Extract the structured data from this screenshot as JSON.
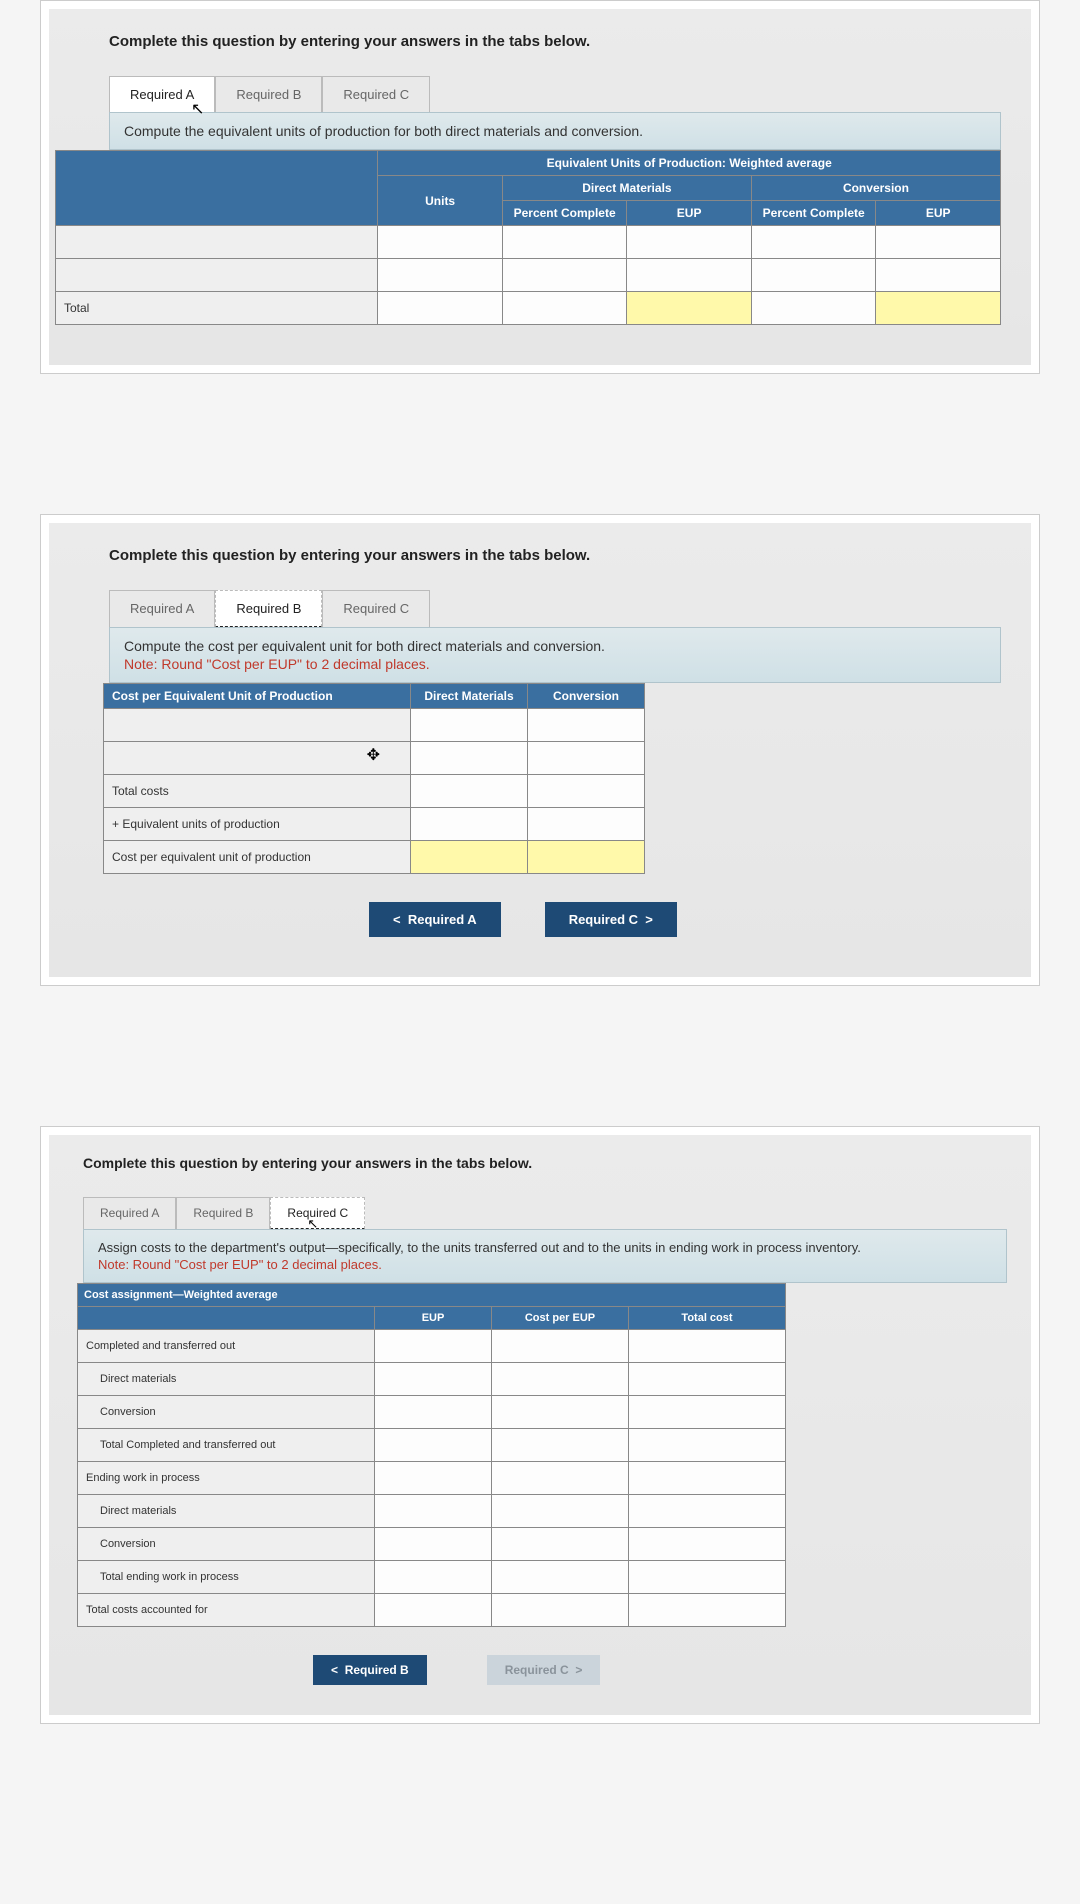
{
  "common": {
    "instruction": "Complete this question by entering your answers in the tabs below.",
    "tabs": {
      "a": "Required A",
      "b": "Required B",
      "c": "Required C"
    },
    "nav": {
      "prevA": "Required A",
      "prevB": "Required B",
      "nextC": "Required C"
    }
  },
  "cardA": {
    "prompt": "Compute the equivalent units of production for both direct materials and conversion.",
    "headers": {
      "main": "Equivalent Units of Production: Weighted average",
      "units": "Units",
      "dm": "Direct Materials",
      "conv": "Conversion",
      "pct": "Percent Complete",
      "eup": "EUP"
    },
    "rows": {
      "total": "Total"
    }
  },
  "cardB": {
    "prompt": "Compute the cost per equivalent unit for both direct materials and conversion.",
    "note": "Note: Round \"Cost per EUP\" to 2 decimal places.",
    "headers": {
      "title": "Cost per Equivalent Unit of Production",
      "dm": "Direct Materials",
      "conv": "Conversion"
    },
    "rows": {
      "totalCosts": "Total costs",
      "eup": "+ Equivalent units of production",
      "cpu": "Cost per equivalent unit of production"
    }
  },
  "cardC": {
    "prompt": "Assign costs to the department's output—specifically, to the units transferred out and to the units in ending work in process inventory.",
    "note": "Note: Round \"Cost per EUP\" to 2 decimal places.",
    "headers": {
      "title": "Cost assignment—Weighted average",
      "eup": "EUP",
      "cpe": "Cost per EUP",
      "tc": "Total cost"
    },
    "rows": {
      "cto": "Completed and transferred out",
      "dm": "Direct materials",
      "conv": "Conversion",
      "tcto": "Total Completed and transferred out",
      "ewip": "Ending work in process",
      "tewip": "Total ending work in process",
      "tca": "Total costs accounted for"
    }
  }
}
